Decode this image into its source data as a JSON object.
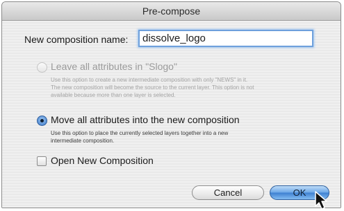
{
  "dialog": {
    "title": "Pre-compose"
  },
  "name_field": {
    "label": "New composition name:",
    "value": "dissolve_logo"
  },
  "options": [
    {
      "label": "Leave all attributes in \"Slogo\"",
      "description": "Use this option to create a new intermediate composition with only \"NEWS\" in it.\nThe new composition will become the source to the current layer.  This option is not\navailable because more than one layer is selected.",
      "selected": false,
      "enabled": false
    },
    {
      "label": "Move all attributes into the new composition",
      "description": "Use this option to place the currently selected layers together into a new\nintermediate composition.",
      "selected": true,
      "enabled": true
    }
  ],
  "open_new_composition": {
    "label": "Open New Composition",
    "checked": false
  },
  "buttons": {
    "cancel": "Cancel",
    "ok": "OK"
  },
  "colors": {
    "default_button": "#5f9de3",
    "focus_ring": "#6ea0dc"
  }
}
